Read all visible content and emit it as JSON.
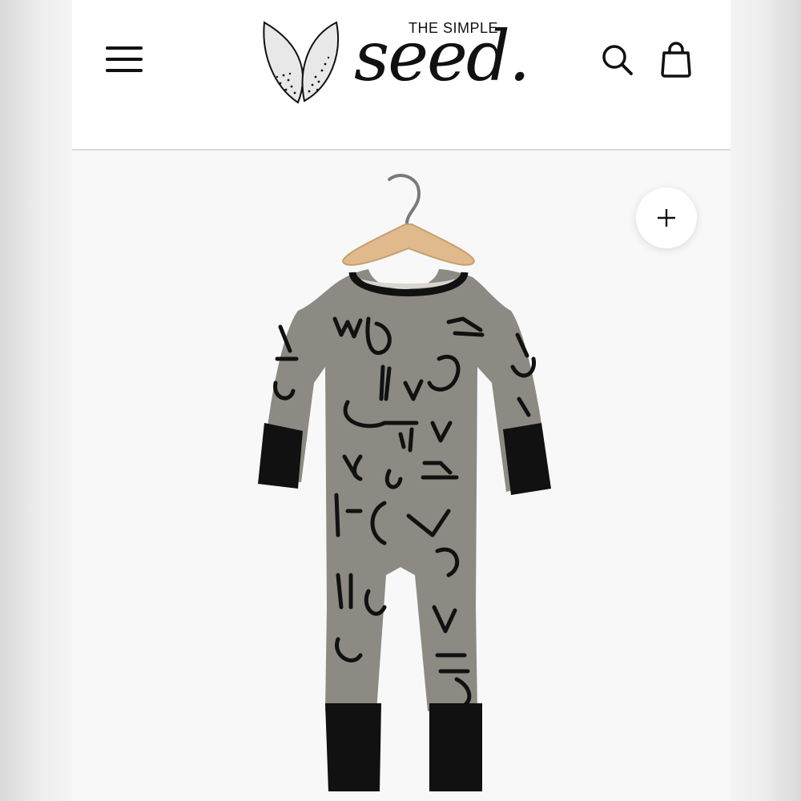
{
  "header": {
    "menu_icon": "hamburger-menu-icon",
    "brand": {
      "tagline": "THE SIMPLE",
      "wordmark": "seed.",
      "emblem_icon": "seed-leaf-logo-icon"
    },
    "search_icon": "search-icon",
    "cart_icon": "shopping-bag-icon"
  },
  "gallery": {
    "zoom_icon": "plus-icon",
    "product_image": "romper-on-hanger"
  },
  "colors": {
    "text": "#111111",
    "romper": "#8c8a82",
    "cuffs": "#111111",
    "divider": "#dcdcdc",
    "hanger": "#e0b98c"
  }
}
